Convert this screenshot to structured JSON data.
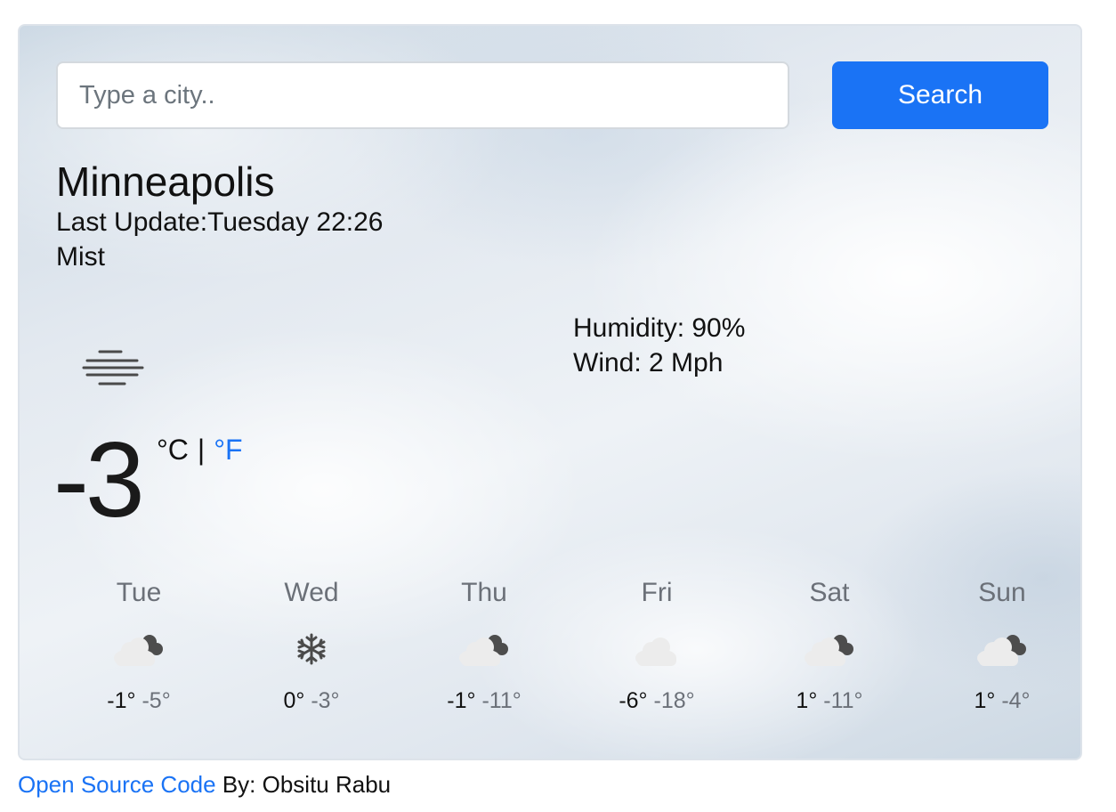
{
  "search": {
    "placeholder": "Type a city..",
    "button_label": "Search"
  },
  "current": {
    "city": "Minneapolis",
    "last_update": "Last Update:Tuesday 22:26",
    "description": "Mist",
    "icon": "mist-icon",
    "humidity": "Humidity: 90%",
    "wind": "Wind: 2 Mph",
    "temperature": "-3",
    "unit_celsius": "°C",
    "unit_separator": "|",
    "unit_fahrenheit": "°F"
  },
  "forecast": [
    {
      "day": "Tue",
      "icon": "partly-cloudy-night-icon",
      "max": "-1°",
      "min": "-5°"
    },
    {
      "day": "Wed",
      "icon": "snowflake-icon",
      "max": "0°",
      "min": "-3°"
    },
    {
      "day": "Thu",
      "icon": "partly-cloudy-night-icon",
      "max": "-1°",
      "min": "-11°"
    },
    {
      "day": "Fri",
      "icon": "cloud-icon",
      "max": "-6°",
      "min": "-18°"
    },
    {
      "day": "Sat",
      "icon": "partly-cloudy-night-icon",
      "max": "1°",
      "min": "-11°"
    },
    {
      "day": "Sun",
      "icon": "partly-cloudy-night-icon",
      "max": "1°",
      "min": "-4°"
    }
  ],
  "footer": {
    "link_text": "Open Source Code",
    "byline": " By: Obsitu Rabu"
  },
  "colors": {
    "accent": "#1a73f5",
    "muted": "#6b7078"
  }
}
